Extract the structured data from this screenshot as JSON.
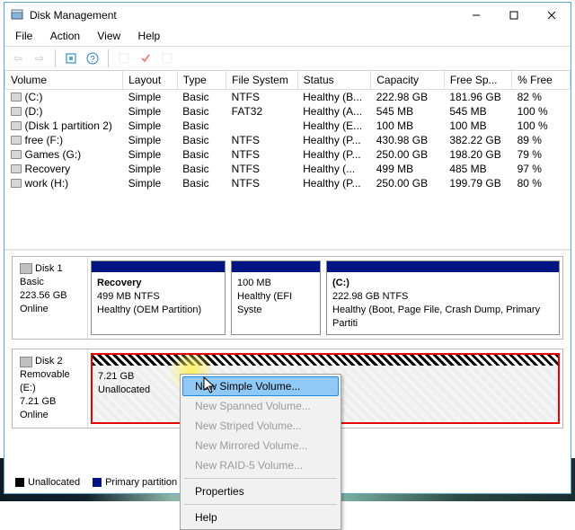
{
  "window": {
    "title": "Disk Management"
  },
  "menubar": {
    "file": "File",
    "action": "Action",
    "view": "View",
    "help": "Help"
  },
  "table": {
    "headers": {
      "volume": "Volume",
      "layout": "Layout",
      "type": "Type",
      "fs": "File System",
      "status": "Status",
      "capacity": "Capacity",
      "free": "Free Sp...",
      "pct": "% Free"
    },
    "rows": [
      {
        "volume": "(C:)",
        "layout": "Simple",
        "type": "Basic",
        "fs": "NTFS",
        "status": "Healthy (B...",
        "capacity": "222.98 GB",
        "free": "181.96 GB",
        "pct": "82 %"
      },
      {
        "volume": "(D:)",
        "layout": "Simple",
        "type": "Basic",
        "fs": "FAT32",
        "status": "Healthy (A...",
        "capacity": "545 MB",
        "free": "545 MB",
        "pct": "100 %"
      },
      {
        "volume": "(Disk 1 partition 2)",
        "layout": "Simple",
        "type": "Basic",
        "fs": "",
        "status": "Healthy (E...",
        "capacity": "100 MB",
        "free": "100 MB",
        "pct": "100 %"
      },
      {
        "volume": "free (F:)",
        "layout": "Simple",
        "type": "Basic",
        "fs": "NTFS",
        "status": "Healthy (P...",
        "capacity": "430.98 GB",
        "free": "382.22 GB",
        "pct": "89 %"
      },
      {
        "volume": "Games (G:)",
        "layout": "Simple",
        "type": "Basic",
        "fs": "NTFS",
        "status": "Healthy (P...",
        "capacity": "250.00 GB",
        "free": "198.20 GB",
        "pct": "79 %"
      },
      {
        "volume": "Recovery",
        "layout": "Simple",
        "type": "Basic",
        "fs": "NTFS",
        "status": "Healthy (...",
        "capacity": "499 MB",
        "free": "485 MB",
        "pct": "97 %"
      },
      {
        "volume": "work (H:)",
        "layout": "Simple",
        "type": "Basic",
        "fs": "NTFS",
        "status": "Healthy (P...",
        "capacity": "250.00 GB",
        "free": "199.79 GB",
        "pct": "80 %"
      }
    ]
  },
  "disks": {
    "d1": {
      "name": "Disk 1",
      "type": "Basic",
      "size": "223.56 GB",
      "status": "Online",
      "p1": {
        "title": "Recovery",
        "line1": "499 MB NTFS",
        "line2": "Healthy (OEM Partition)"
      },
      "p2": {
        "title": "",
        "line1": "100 MB",
        "line2": "Healthy (EFI Syste"
      },
      "p3": {
        "title": "(C:)",
        "line1": "222.98 GB NTFS",
        "line2": "Healthy (Boot, Page File, Crash Dump, Primary Partiti"
      }
    },
    "d2": {
      "name": "Disk 2",
      "type": "Removable (E:)",
      "size": "7.21 GB",
      "status": "Online",
      "p1": {
        "line1": "7.21 GB",
        "line2": "Unallocated"
      }
    }
  },
  "legend": {
    "unalloc": "Unallocated",
    "primary": "Primary partition"
  },
  "context_menu": {
    "simple": "New Simple Volume...",
    "spanned": "New Spanned Volume...",
    "striped": "New Striped Volume...",
    "mirrored": "New Mirrored Volume...",
    "raid5": "New RAID-5 Volume...",
    "props": "Properties",
    "help": "Help"
  }
}
